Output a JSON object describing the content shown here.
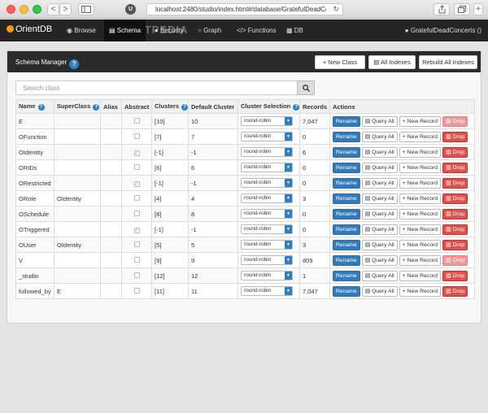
{
  "browser": {
    "url": "localhost:2480/studio/index.html#/database/GratefulDeadConce",
    "back_label": "<",
    "forward_label": ">",
    "ext_label": "U",
    "reload_label": "↻"
  },
  "nav": {
    "logo": "OrientDB",
    "watermark": "SOFTPEDIA",
    "items": [
      {
        "label": "Browse",
        "icon": "eye-icon"
      },
      {
        "label": "Schema",
        "icon": "table-icon"
      },
      {
        "label": "Security",
        "icon": "user-icon"
      },
      {
        "label": "Graph",
        "icon": "circle-icon"
      },
      {
        "label": "Functions",
        "icon": "code-icon"
      },
      {
        "label": "DB",
        "icon": "database-icon"
      }
    ],
    "user": "GratefulDeadConcerts ()"
  },
  "schema": {
    "title": "Schema Manager",
    "new_class": "+ New Class",
    "all_indexes": "All Indexes",
    "rebuild_all": "Rebuild All Indexes",
    "search_placeholder": "Search class"
  },
  "table": {
    "headers": [
      "Name",
      "SuperClass",
      "Alias",
      "Abstract",
      "Clusters",
      "Default Cluster",
      "Cluster Selection",
      "Records",
      "Actions"
    ],
    "actions": {
      "rename": "Rename",
      "query_all": "Query All",
      "new_record": "+ New Record",
      "drop": "Drop"
    },
    "rows": [
      {
        "name": "E",
        "superclass": "",
        "alias": "",
        "abstract": false,
        "clusters": "[10]",
        "default_cluster": "10",
        "selection": "round-robin",
        "records": "7,047",
        "drop_enabled": false
      },
      {
        "name": "OFunction",
        "superclass": "",
        "alias": "",
        "abstract": false,
        "clusters": "[7]",
        "default_cluster": "7",
        "selection": "round-robin",
        "records": "0",
        "drop_enabled": true
      },
      {
        "name": "OIdentity",
        "superclass": "",
        "alias": "",
        "abstract": true,
        "clusters": "[-1]",
        "default_cluster": "-1",
        "selection": "round-robin",
        "records": "6",
        "drop_enabled": true
      },
      {
        "name": "ORIDs",
        "superclass": "",
        "alias": "",
        "abstract": false,
        "clusters": "[6]",
        "default_cluster": "6",
        "selection": "round-robin",
        "records": "0",
        "drop_enabled": true
      },
      {
        "name": "ORestricted",
        "superclass": "",
        "alias": "",
        "abstract": true,
        "clusters": "[-1]",
        "default_cluster": "-1",
        "selection": "round-robin",
        "records": "0",
        "drop_enabled": true
      },
      {
        "name": "ORole",
        "superclass": "OIdentity",
        "alias": "",
        "abstract": false,
        "clusters": "[4]",
        "default_cluster": "4",
        "selection": "round-robin",
        "records": "3",
        "drop_enabled": true
      },
      {
        "name": "OSchedule",
        "superclass": "",
        "alias": "",
        "abstract": false,
        "clusters": "[8]",
        "default_cluster": "8",
        "selection": "round-robin",
        "records": "0",
        "drop_enabled": true
      },
      {
        "name": "OTriggered",
        "superclass": "",
        "alias": "",
        "abstract": true,
        "clusters": "[-1]",
        "default_cluster": "-1",
        "selection": "round-robin",
        "records": "0",
        "drop_enabled": true
      },
      {
        "name": "OUser",
        "superclass": "OIdentity",
        "alias": "",
        "abstract": false,
        "clusters": "[5]",
        "default_cluster": "5",
        "selection": "round-robin",
        "records": "3",
        "drop_enabled": true
      },
      {
        "name": "V",
        "superclass": "",
        "alias": "",
        "abstract": false,
        "clusters": "[9]",
        "default_cluster": "9",
        "selection": "round-robin",
        "records": "809",
        "drop_enabled": false
      },
      {
        "name": "_studio",
        "superclass": "",
        "alias": "",
        "abstract": false,
        "clusters": "[12]",
        "default_cluster": "12",
        "selection": "round-robin",
        "records": "1",
        "drop_enabled": true
      },
      {
        "name": "followed_by",
        "superclass": "E",
        "alias": "",
        "abstract": false,
        "clusters": "[11]",
        "default_cluster": "11",
        "selection": "round-robin",
        "records": "7,047",
        "drop_enabled": true
      }
    ]
  }
}
